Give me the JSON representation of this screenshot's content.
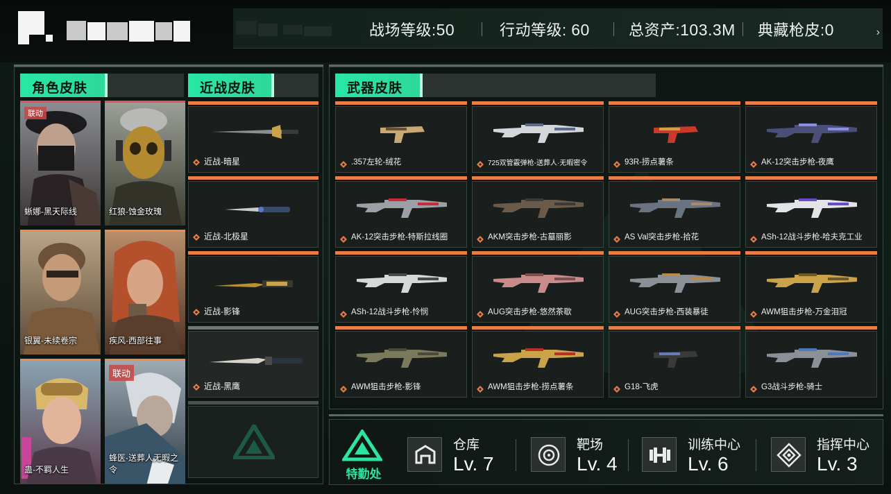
{
  "header": {
    "stats": [
      {
        "label": "战场等级:",
        "value": "50"
      },
      {
        "label": "行动等级: ",
        "value": "60"
      },
      {
        "label": "总资产:",
        "value": "103.3M"
      },
      {
        "label": "典藏枪皮:",
        "value": "0"
      }
    ],
    "arrow": "›"
  },
  "sections": {
    "character": "角色皮肤",
    "melee": "近战皮肤",
    "weapon": "武器皮肤"
  },
  "characters": [
    {
      "name": "蜥娜-黑天际线",
      "badge": "联动",
      "accent": "#e4505a"
    },
    {
      "name": "红狼-蚀金玫瑰",
      "badge": "",
      "accent": "#e4505a"
    },
    {
      "name": "银翼-未续卷宗",
      "badge": "",
      "accent": "#f08a4a"
    },
    {
      "name": "疾风-西部往事",
      "badge": "",
      "accent": "#f08a4a"
    },
    {
      "name": "蛊-不羁人生",
      "badge": "",
      "accent": "#f08a4a"
    },
    {
      "name": "蜂医-送葬人无暇之令",
      "badge": "联动",
      "accent": "#f08a4a"
    }
  ],
  "melee": [
    {
      "name": "近战-暗星"
    },
    {
      "name": "近战-北极星"
    },
    {
      "name": "近战-影锋"
    },
    {
      "name": "近战-黑鹰"
    }
  ],
  "weapons": [
    {
      "name": ".357左轮-绒花"
    },
    {
      "name": "725双管霰弹枪-送葬人·无暇密令"
    },
    {
      "name": "93R-捞点薯条"
    },
    {
      "name": "AK-12突击步枪-夜鹰"
    },
    {
      "name": "AK-12突击步枪-特斯拉线圈"
    },
    {
      "name": "AKM突击步枪-古墓丽影"
    },
    {
      "name": "AS Val突击步枪-拾花"
    },
    {
      "name": "ASh-12战斗步枪-哈夫克工业"
    },
    {
      "name": "ASh-12战斗步枪-怜悯"
    },
    {
      "name": "AUG突击步枪-悠然茶歇"
    },
    {
      "name": "AUG突击步枪-西装暴徒"
    },
    {
      "name": "AWM狙击步枪-万金泪冠"
    },
    {
      "name": "AWM狙击步枪-影锋"
    },
    {
      "name": "AWM狙击步枪-捞点薯条"
    },
    {
      "name": "G18-飞虎"
    },
    {
      "name": "G3战斗步枪-骑士"
    }
  ],
  "facilities": {
    "logo_text": "特勤处",
    "items": [
      {
        "name": "仓库",
        "level": "Lv. 7",
        "icon": "warehouse-icon"
      },
      {
        "name": "靶场",
        "level": "Lv. 4",
        "icon": "target-icon"
      },
      {
        "name": "训练中心",
        "level": "Lv. 6",
        "icon": "dumbbell-icon"
      },
      {
        "name": "指挥中心",
        "level": "Lv. 3",
        "icon": "command-icon"
      }
    ]
  },
  "colors": {
    "accent_green": "#28e7a4",
    "rarity_orange": "#e87e46",
    "rarity_red": "#e4505a"
  }
}
